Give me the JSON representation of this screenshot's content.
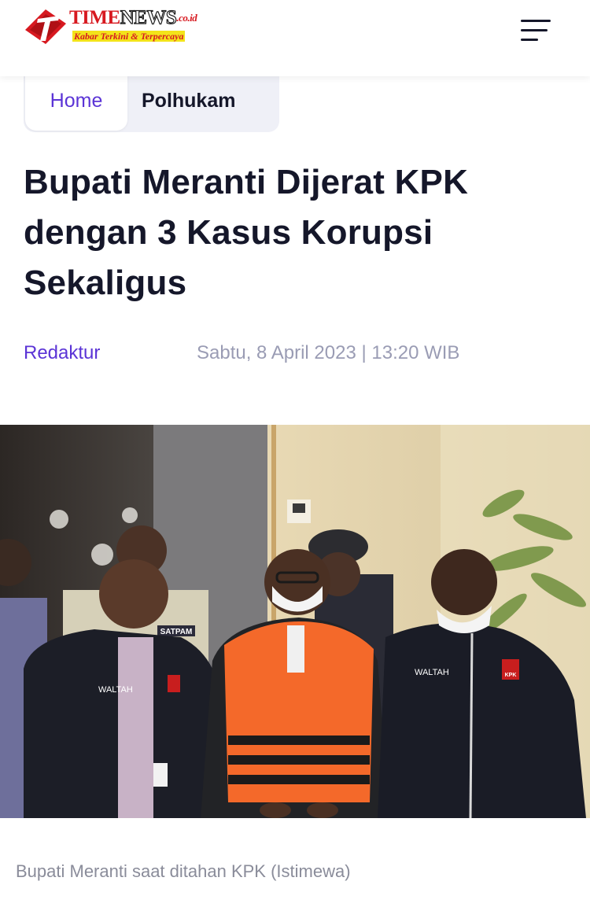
{
  "header": {
    "logo": {
      "word1": "TIME",
      "word2": "NEWS",
      "tld": ".co.id",
      "tagline": "Kabar Terkini & Terpercaya",
      "colors": {
        "red": "#d71920",
        "yellow": "#f3e31a"
      }
    },
    "menu_icon": "hamburger-menu-icon"
  },
  "breadcrumb": {
    "home": "Home",
    "category": "Polhukam"
  },
  "article": {
    "title": "Bupati Meranti Dijerat KPK dengan 3 Kasus Korupsi Sekaligus",
    "author": "Redaktur",
    "date": "Sabtu, 8 April 2023 | 13:20 WIB",
    "image_caption": "Bupati Meranti saat ditahan KPK (Istimewa)",
    "image_text": {
      "vest_left": "WALTAH",
      "vest_right": "WALTAH",
      "badge": "KPK",
      "security": "SATPAM"
    }
  },
  "colors": {
    "accent": "#5b34d6",
    "title": "#15172a",
    "meta": "#9a9cb4",
    "breadcrumb_bg": "#eff0f7"
  }
}
